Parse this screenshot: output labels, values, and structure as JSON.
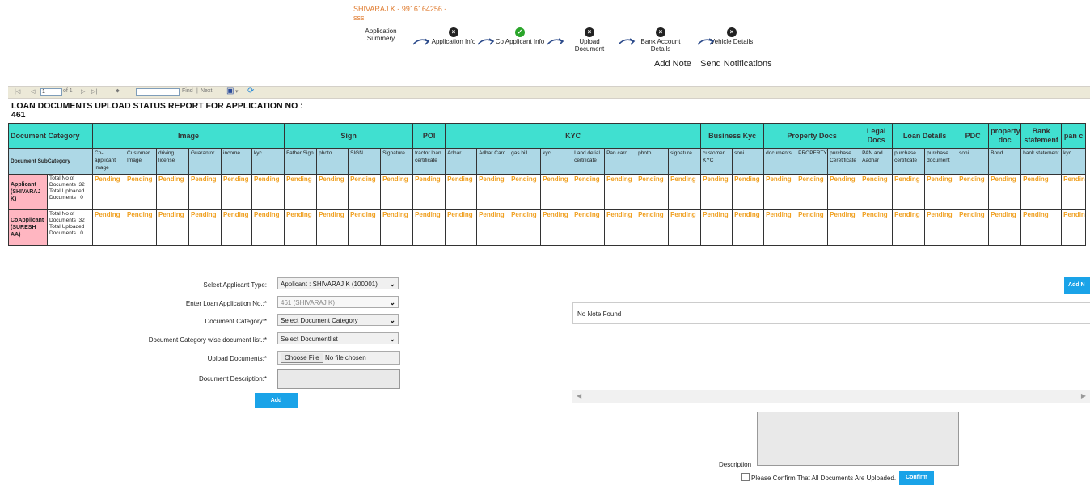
{
  "applicant_header": "SHIVARAJ K - 9916164256 - sss",
  "steps": [
    {
      "label": "Application Summery",
      "icon": "none",
      "icon_name": ""
    },
    {
      "label": "Application Info",
      "icon": "x",
      "icon_name": "x-circle-icon"
    },
    {
      "label": "Co Applicant Info",
      "icon": "check",
      "icon_name": "check-circle-icon"
    },
    {
      "label": "Upload Document",
      "icon": "x",
      "icon_name": "x-circle-icon"
    },
    {
      "label": "Bank Account Details",
      "icon": "x",
      "icon_name": "x-circle-icon"
    },
    {
      "label": "Vehicle Details",
      "icon": "x",
      "icon_name": "x-circle-icon"
    }
  ],
  "links": {
    "add_note": "Add Note",
    "send_notifications": "Send Notifications"
  },
  "toolbar": {
    "page_value": "1",
    "page_of": "of 1",
    "find": "Find",
    "next": "Next"
  },
  "report": {
    "title": "LOAN DOCUMENTS UPLOAD STATUS REPORT FOR APPLICATION NO :",
    "app_no": "461",
    "category_header": "Document Category",
    "subcategory_header": "Document SubCategory",
    "categories": [
      {
        "name": "Image",
        "span": 6
      },
      {
        "name": "Sign",
        "span": 4
      },
      {
        "name": "POI",
        "span": 1
      },
      {
        "name": "KYC",
        "span": 8
      },
      {
        "name": "Business Kyc",
        "span": 2
      },
      {
        "name": "Property Docs",
        "span": 3
      },
      {
        "name": "Legal Docs",
        "span": 1
      },
      {
        "name": "Loan Details",
        "span": 2
      },
      {
        "name": "PDC",
        "span": 1
      },
      {
        "name": "property doc",
        "span": 1
      },
      {
        "name": "Bank statement",
        "span": 1
      },
      {
        "name": "pan c",
        "span": 1
      }
    ],
    "subcategories": [
      "Co-applicant image",
      "Customer Image",
      "driving license",
      "Guarantor",
      "income",
      "kyc",
      "Father Sign",
      "photo",
      "SIGN",
      "Signature",
      "tractor loan certificate",
      "Adhar",
      "Adhar Card",
      "gas bill",
      "kyc",
      "Land detial certificate",
      "Pan card",
      "photo",
      "signature",
      "customer KYC",
      "soni",
      "documents",
      "PROPERTY",
      "purchase Ceretificate",
      "PAN and Aadhar",
      "purchase certificate",
      "purchase document",
      "soni",
      "Bond",
      "bank statement",
      "kyc"
    ],
    "rows": [
      {
        "name": "Applicant (SHIVARAJ K)",
        "counts": "Total No of Documents :32 Total Uploaded Documents : 0",
        "status": "Pending"
      },
      {
        "name": "CoApplicant (SURESH AA)",
        "counts": "Total No of Documents :32 Total Uploaded Documents : 0",
        "status": "Pending"
      }
    ]
  },
  "form": {
    "applicant_type_label": "Select Applicant Type:",
    "applicant_type_value": "Applicant : SHIVARAJ K (100001)",
    "loan_no_label": "Enter Loan Application No.:*",
    "loan_no_value": "461 (SHIVARAJ K)",
    "doc_category_label": "Document Category:*",
    "doc_category_value": "Select Document Category",
    "doc_list_label": "Document Category wise document list.:*",
    "doc_list_value": "Select Documentlist",
    "upload_label": "Upload Documents:*",
    "choose_file": "Choose File",
    "no_file": "No file chosen",
    "description_label": "Document Description:*",
    "add_button": "Add"
  },
  "notes": {
    "add_button": "Add N",
    "empty_text": "No Note Found",
    "description_label": "Description :",
    "confirm_text": "Please Confirm That All Documents Are Uploaded.",
    "confirm_button": "Confirm"
  }
}
